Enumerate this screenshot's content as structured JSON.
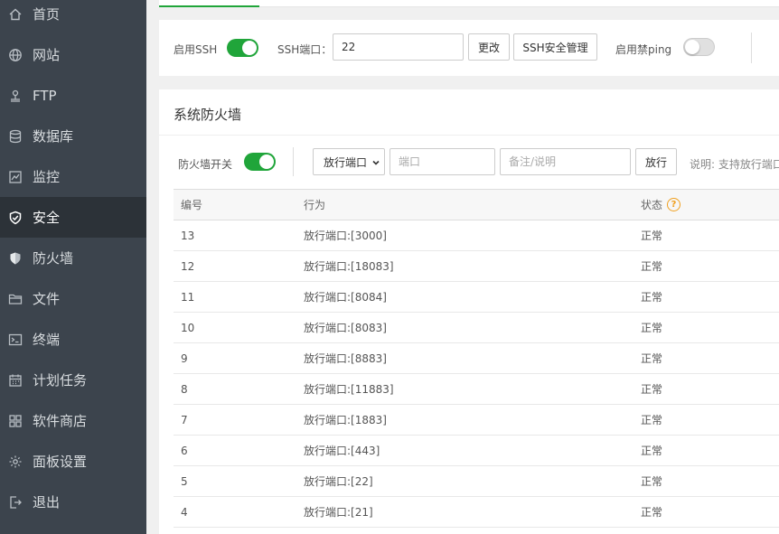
{
  "sidebar": {
    "items": [
      {
        "label": "首页",
        "icon": "home-icon"
      },
      {
        "label": "网站",
        "icon": "globe-icon"
      },
      {
        "label": "FTP",
        "icon": "ftp-icon"
      },
      {
        "label": "数据库",
        "icon": "database-icon"
      },
      {
        "label": "监控",
        "icon": "monitor-icon"
      },
      {
        "label": "安全",
        "icon": "shield-check-icon",
        "active": true
      },
      {
        "label": "防火墙",
        "icon": "shield-icon"
      },
      {
        "label": "文件",
        "icon": "folder-icon"
      },
      {
        "label": "终端",
        "icon": "terminal-icon"
      },
      {
        "label": "计划任务",
        "icon": "calendar-icon"
      },
      {
        "label": "软件商店",
        "icon": "grid-icon"
      },
      {
        "label": "面板设置",
        "icon": "gear-icon"
      },
      {
        "label": "退出",
        "icon": "logout-icon"
      }
    ]
  },
  "ssh": {
    "enable_label": "启用SSH",
    "enable_on": true,
    "port_label": "SSH端口：",
    "port_value": "22",
    "change_button": "更改",
    "manage_button": "SSH安全管理",
    "ping_label": "启用禁ping",
    "ping_on": false
  },
  "firewall": {
    "title": "系统防火墙",
    "switch_label": "防火墙开关",
    "switch_on": true,
    "action_select": "放行端口",
    "port_placeholder": "端口",
    "remark_placeholder": "备注/说明",
    "allow_button": "放行",
    "hint": "说明: 支持放行端口"
  },
  "table": {
    "headers": {
      "id": "编号",
      "action": "行为",
      "status": "状态"
    },
    "rows": [
      {
        "id": "13",
        "action": "放行端口:[3000]",
        "status": "正常"
      },
      {
        "id": "12",
        "action": "放行端口:[18083]",
        "status": "正常"
      },
      {
        "id": "11",
        "action": "放行端口:[8084]",
        "status": "正常"
      },
      {
        "id": "10",
        "action": "放行端口:[8083]",
        "status": "正常"
      },
      {
        "id": "9",
        "action": "放行端口:[8883]",
        "status": "正常"
      },
      {
        "id": "8",
        "action": "放行端口:[11883]",
        "status": "正常"
      },
      {
        "id": "7",
        "action": "放行端口:[1883]",
        "status": "正常"
      },
      {
        "id": "6",
        "action": "放行端口:[443]",
        "status": "正常"
      },
      {
        "id": "5",
        "action": "放行端口:[22]",
        "status": "正常"
      },
      {
        "id": "4",
        "action": "放行端口:[21]",
        "status": "正常"
      }
    ]
  },
  "colors": {
    "accent": "#20a53a",
    "sidebar_bg": "#3c444d",
    "sidebar_active_bg": "#2c3238",
    "help_icon": "#f0a020"
  }
}
